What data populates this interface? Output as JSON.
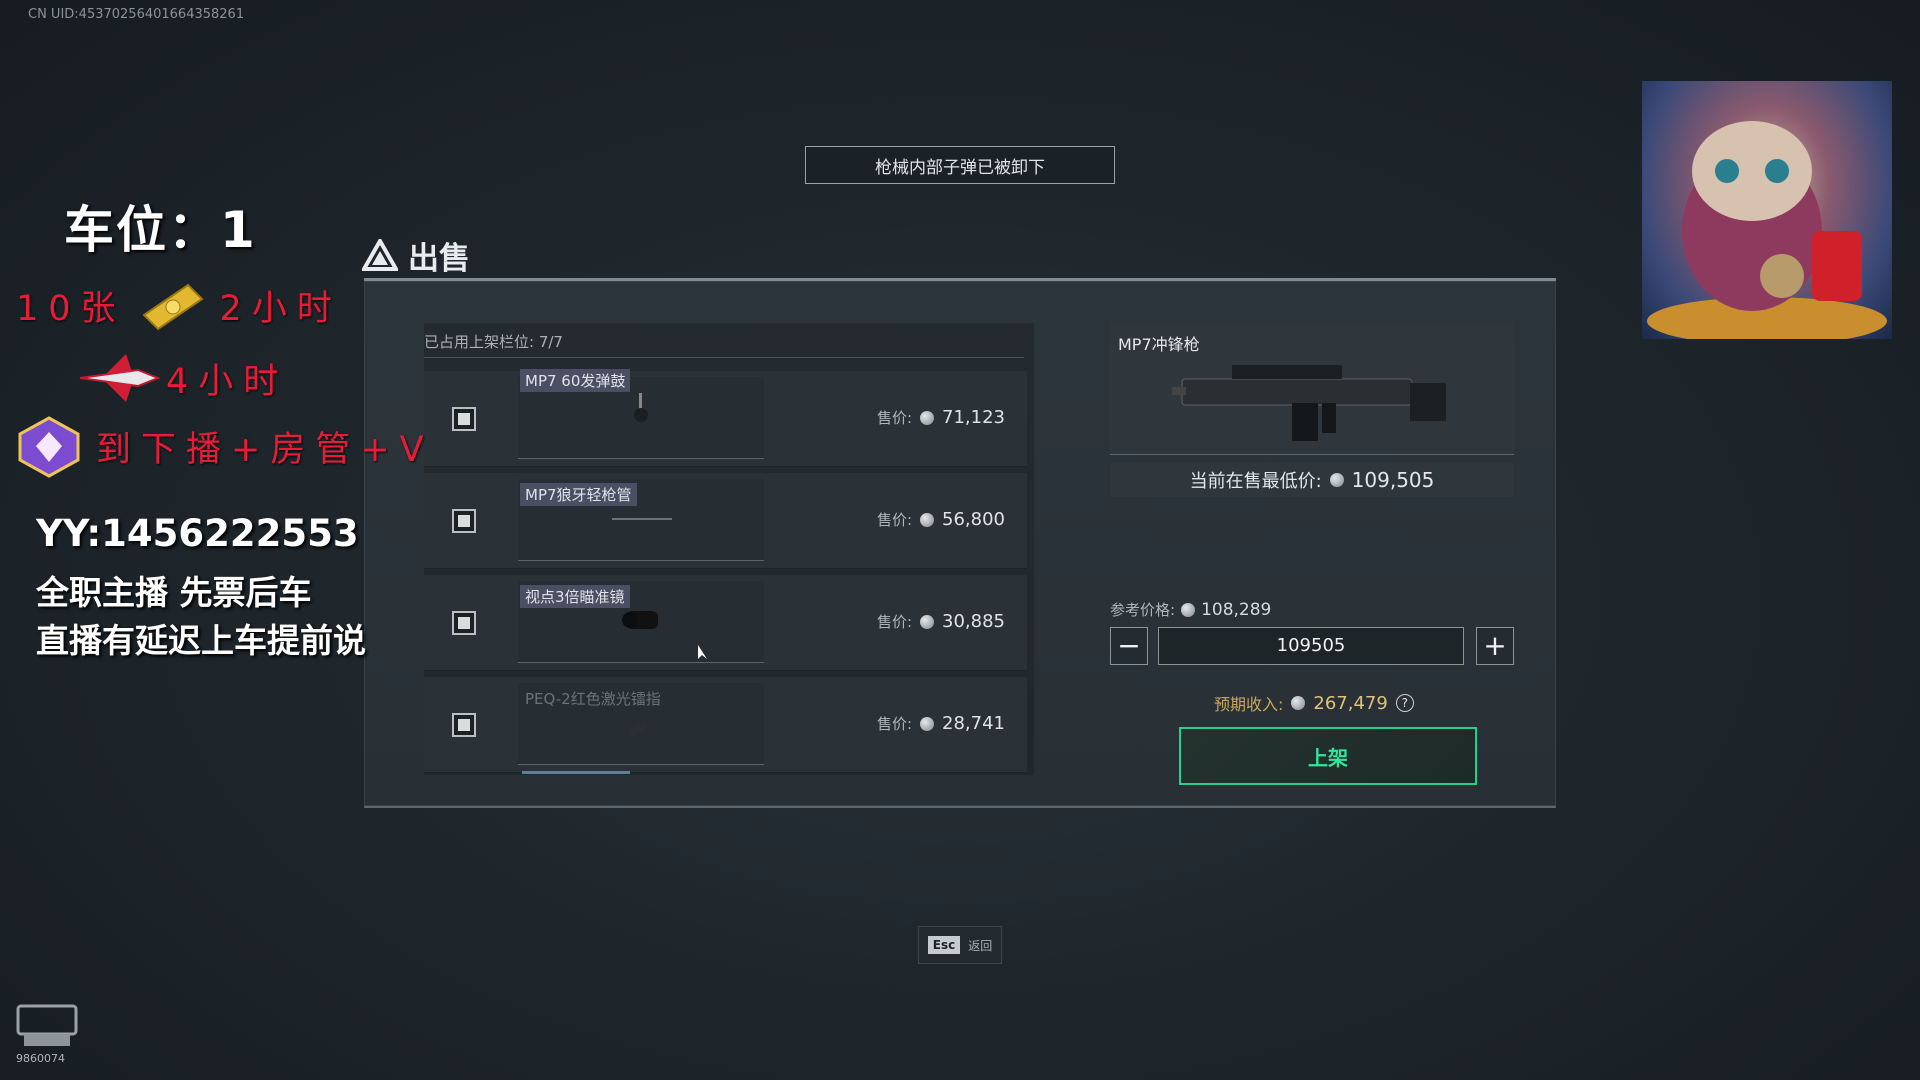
{
  "uid": "CN UID:45370256401664358261",
  "notice": "枪械内部子弹已被卸下",
  "sell": {
    "title": "出售",
    "slots_label": "已占用上架栏位: 7/7",
    "price_label": "售价:",
    "items": [
      {
        "name": "MP7 60发弹鼓",
        "price": "71,123"
      },
      {
        "name": "MP7狼牙轻枪管",
        "price": "56,800"
      },
      {
        "name": "视点3倍瞄准镜",
        "price": "30,885"
      },
      {
        "name": "PEQ-2红色激光镭指",
        "price": "28,741"
      }
    ]
  },
  "detail": {
    "title": "MP7冲锋枪",
    "min_price_label": "当前在售最低价:",
    "min_price": "109,505",
    "ref_label": "参考价格:",
    "ref_price": "108,289",
    "input_value": "109505",
    "expected_label": "预期收入:",
    "expected_value": "267,479",
    "help": "?",
    "list_button": "上架"
  },
  "esc": {
    "key": "Esc",
    "label": "返回"
  },
  "overlay": {
    "slot": "车位：1",
    "line1_a": "10张",
    "line1_b": "2小时",
    "line2": "4小时",
    "line3": "到下播+房管+V",
    "yy": "YY:1456222553",
    "line4": "全职主播 先票后车",
    "line5": "直播有延迟上车提前说",
    "room_no": "9860074"
  },
  "colors": {
    "accent_green": "#26d08a",
    "overlay_red": "#e81c3a",
    "gold": "#c9a65c"
  }
}
